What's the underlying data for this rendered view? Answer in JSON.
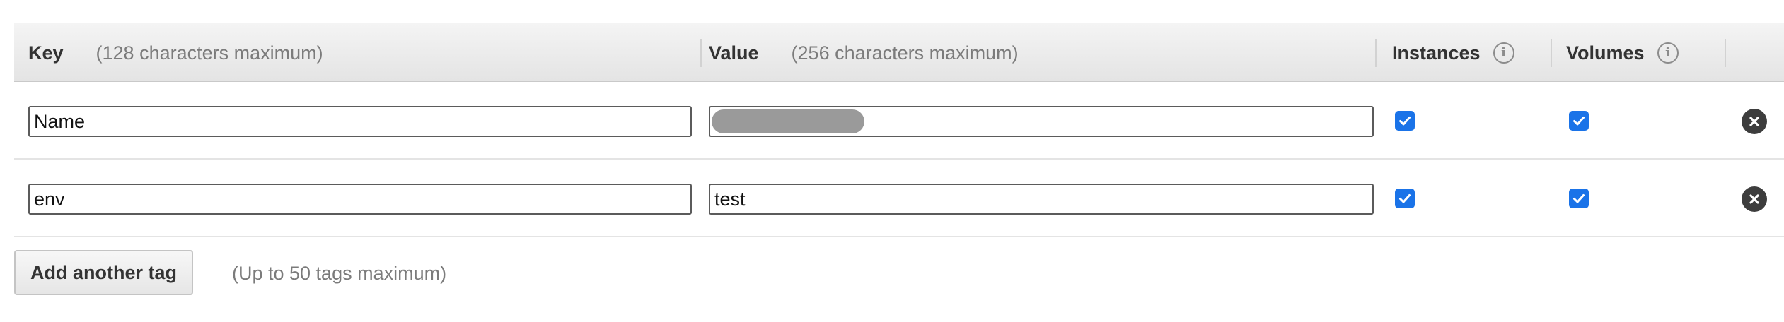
{
  "table": {
    "headers": {
      "key": {
        "title": "Key",
        "hint": "(128 characters maximum)"
      },
      "value": {
        "title": "Value",
        "hint": "(256 characters maximum)"
      },
      "instances": {
        "title": "Instances",
        "icon": "info-icon",
        "icon_glyph": "i"
      },
      "volumes": {
        "title": "Volumes",
        "icon": "info-icon",
        "icon_glyph": "i"
      }
    },
    "rows": [
      {
        "key": "Name",
        "value": "",
        "value_redacted": true,
        "instances": true,
        "volumes": true
      },
      {
        "key": "env",
        "value": "test",
        "value_redacted": false,
        "instances": true,
        "volumes": true
      }
    ]
  },
  "footer": {
    "add_button_label": "Add another tag",
    "limit_note": "(Up to 50 tags maximum)"
  },
  "colors": {
    "checkbox": "#1a73e8",
    "remove_icon": "#3d3d3d",
    "hint_text": "#7b7b7b"
  }
}
